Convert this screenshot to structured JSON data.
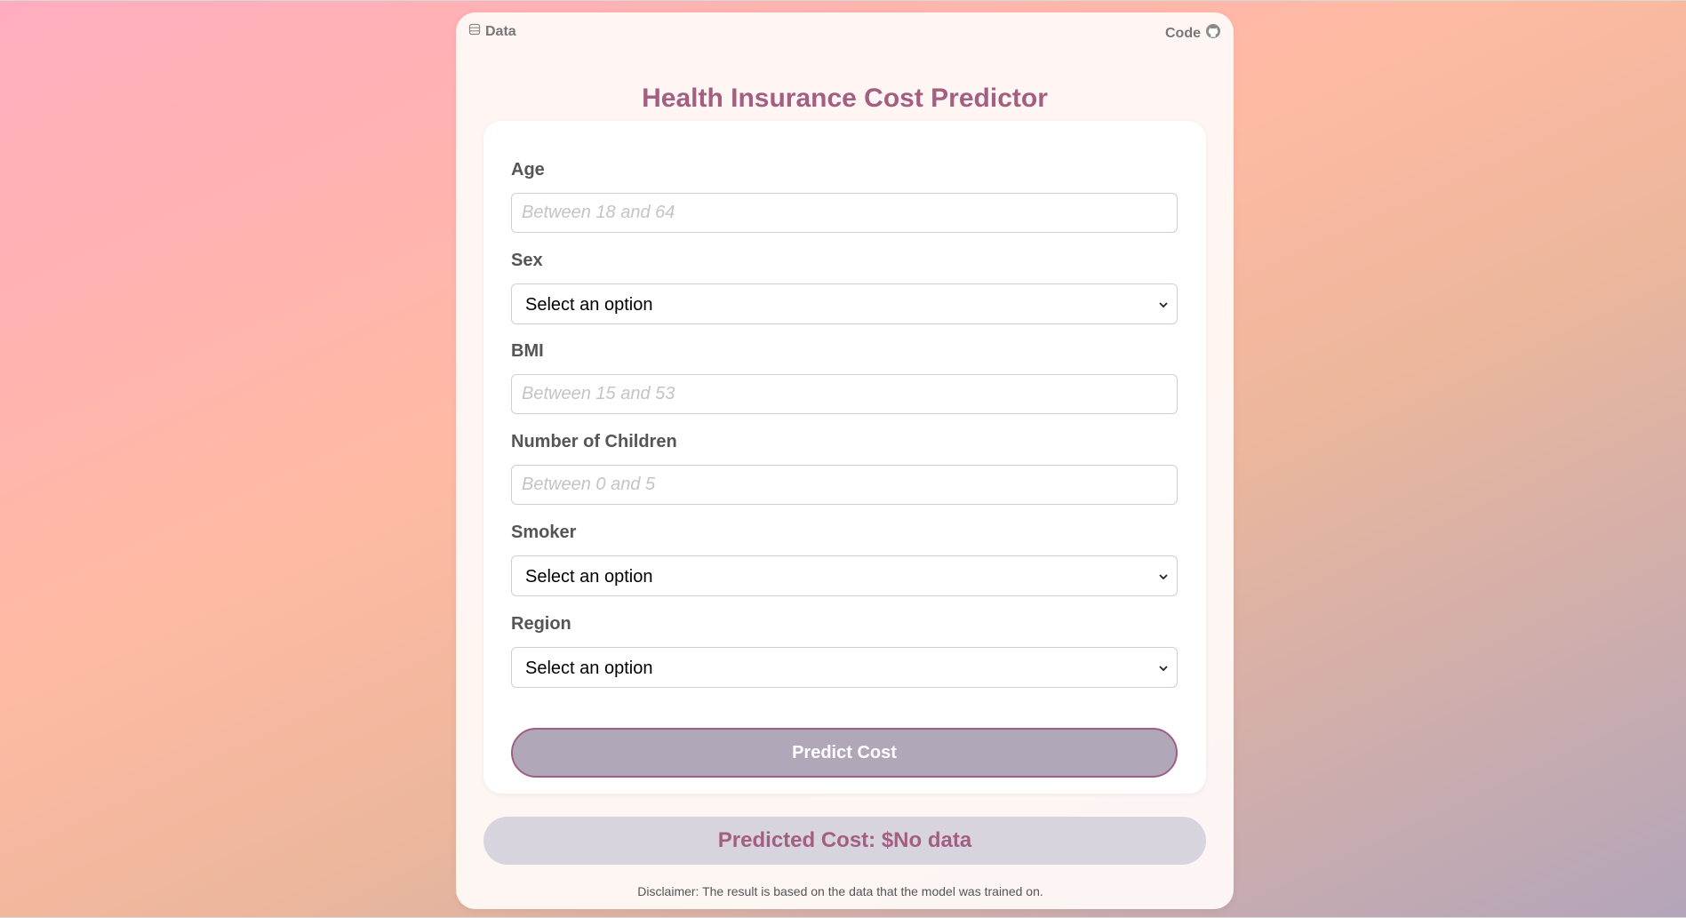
{
  "nav": {
    "data_label": "Data",
    "code_label": "Code"
  },
  "page": {
    "title": "Health Insurance Cost Predictor"
  },
  "form": {
    "age": {
      "label": "Age",
      "placeholder": "Between 18 and 64",
      "value": ""
    },
    "sex": {
      "label": "Sex",
      "selected": "Select an option"
    },
    "bmi": {
      "label": "BMI",
      "placeholder": "Between 15 and 53",
      "value": ""
    },
    "children": {
      "label": "Number of Children",
      "placeholder": "Between 0 and 5",
      "value": ""
    },
    "smoker": {
      "label": "Smoker",
      "selected": "Select an option"
    },
    "region": {
      "label": "Region",
      "selected": "Select an option"
    },
    "submit_label": "Predict Cost"
  },
  "result": {
    "text": "Predicted Cost: $No data"
  },
  "footer": {
    "disclaimer": "Disclaimer: The result is based on the data that the model was trained on."
  },
  "colors": {
    "accent": "#a35f82",
    "button_bg": "#b0a7b9",
    "result_bg": "#d8d4de"
  },
  "icons": {
    "data": "database-icon",
    "code": "github-icon",
    "select": "chevron-down-icon"
  }
}
